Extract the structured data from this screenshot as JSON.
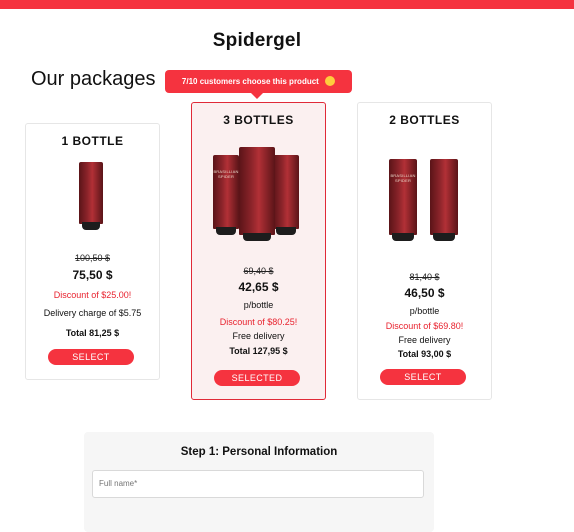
{
  "brand": "Spidergel",
  "section_title": "Our packages",
  "tooltip": "7/10 customers choose this product",
  "product_label": "BRASILLIAN SPIDER",
  "cards": [
    {
      "title": "1 BOTTLE",
      "old_price": "100,50 $",
      "price": "75,50 $",
      "discount": "Discount of $25.00!",
      "delivery": "Delivery charge of $5.75",
      "total": "Total 81,25 $",
      "button": "SELECT"
    },
    {
      "title": "3 BOTTLES",
      "old_price": "69,40 $",
      "price": "42,65 $",
      "per": "p/bottle",
      "discount": "Discount of $80.25!",
      "delivery": "Free delivery",
      "total": "Total 127,95 $",
      "button": "SELECTED"
    },
    {
      "title": "2 BOTTLES",
      "old_price": "81,40 $",
      "price": "46,50 $",
      "per": "p/bottle",
      "discount": "Discount of $69.80!",
      "delivery": "Free delivery",
      "total": "Total 93,00 $",
      "button": "SELECT"
    }
  ],
  "form": {
    "step_title": "Step 1: Personal Information",
    "full_name_placeholder": "Full name*"
  },
  "colors": {
    "accent": "#f5333f",
    "selected_border": "#e02a38",
    "selected_bg": "#fbf0f0"
  }
}
